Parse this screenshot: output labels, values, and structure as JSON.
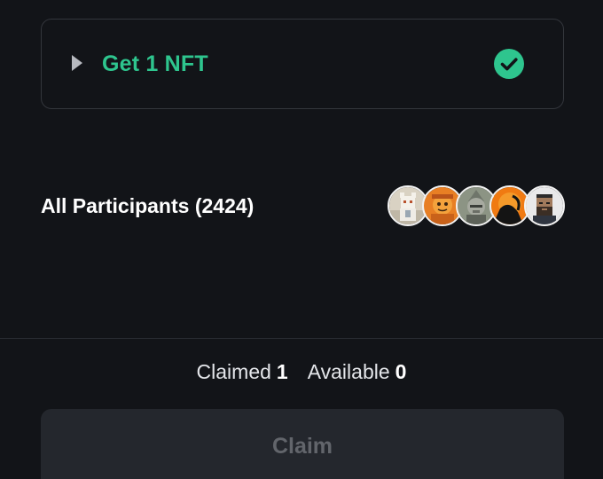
{
  "task": {
    "title": "Get 1 NFT",
    "completed": true,
    "accent_color": "#2ec58e"
  },
  "participants": {
    "label": "All Participants (2424)",
    "avatars": [
      "avatar-white-cat",
      "avatar-orange-character",
      "avatar-grey-ape",
      "avatar-orange-shadow",
      "avatar-bearded-pixel-man"
    ]
  },
  "stats": {
    "claimed_label": "Claimed",
    "claimed_value": "1",
    "available_label": "Available",
    "available_value": "0"
  },
  "claim": {
    "label": "Claim",
    "disabled": true
  }
}
